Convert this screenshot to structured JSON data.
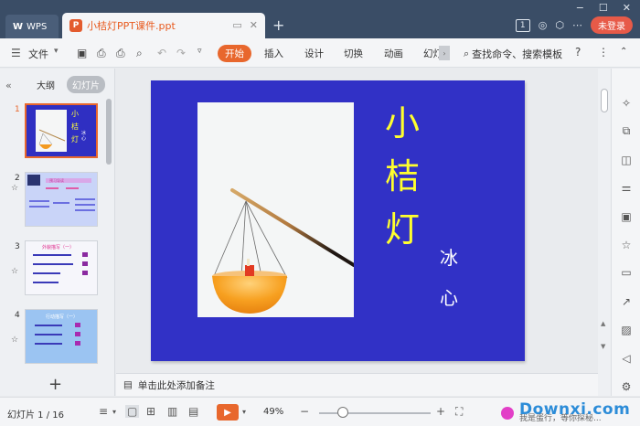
{
  "titlebar": {
    "wps_tab": "WPS",
    "doc_tab": "小桔灯PPT课件.ppt",
    "new_tab": "+",
    "login_btn": "未登录",
    "page_badge": "1",
    "win_min": "−",
    "win_max": "☐",
    "win_close": "✕"
  },
  "menubar": {
    "file": "文件",
    "tabs": [
      "开始",
      "插入",
      "设计",
      "切换",
      "动画",
      "幻灯"
    ],
    "search": "查找命令、搜索模板",
    "help": "?",
    "more": "⋮"
  },
  "leftpanel": {
    "outline_tab": "大纲",
    "slides_tab": "幻灯片",
    "collapse": "«",
    "add_slide": "+",
    "thumbs": [
      {
        "num": "1",
        "title_chars": [
          "小",
          "桔",
          "灯"
        ],
        "author": "冰心"
      },
      {
        "num": "2",
        "title": "预习导读"
      },
      {
        "num": "3",
        "title": "外貌描写（一）"
      },
      {
        "num": "4",
        "title": "行动描写（一）"
      }
    ]
  },
  "slide": {
    "title_chars": [
      "小",
      "桔",
      "灯"
    ],
    "author_chars": [
      "冰",
      "心"
    ]
  },
  "notes": {
    "placeholder": "单击此处添加备注"
  },
  "statusbar": {
    "slide_info": "幻灯片 1 / 16",
    "zoom": "49%",
    "minus": "−",
    "plus": "+"
  },
  "watermark": {
    "brand": "Downxi.com",
    "overlay": "我是蛋行，等你探秘..."
  },
  "colors": {
    "slide_bg": "#3131c6",
    "title_yellow": "#ffff2e",
    "accent_orange": "#e8672d",
    "titlebar_bg": "#3a4d66"
  }
}
